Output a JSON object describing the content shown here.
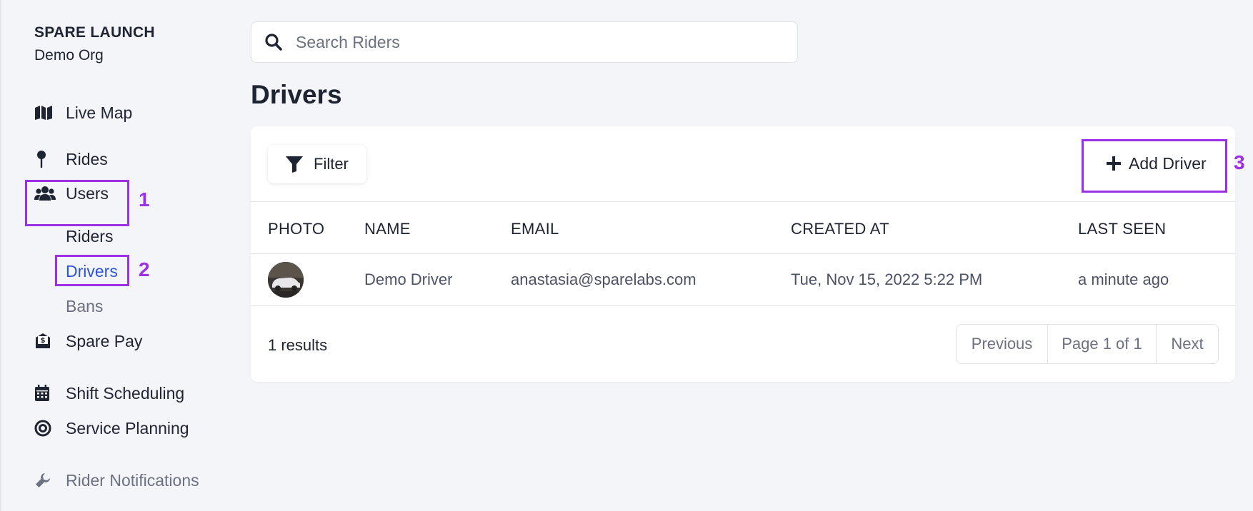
{
  "org": {
    "name": "SPARE LAUNCH",
    "subtitle": "Demo Org"
  },
  "sidebar": {
    "items": [
      {
        "label": "Live Map",
        "icon": "map-icon"
      },
      {
        "label": "Rides",
        "icon": "pin-icon"
      },
      {
        "label": "Users",
        "icon": "users-icon"
      },
      {
        "label": "Spare Pay",
        "icon": "money-envelope-icon"
      },
      {
        "label": "Shift Scheduling",
        "icon": "calendar-icon"
      },
      {
        "label": "Service Planning",
        "icon": "target-icon"
      },
      {
        "label": "Rider Notifications",
        "icon": "wrench-icon"
      }
    ],
    "users_sub": [
      {
        "label": "Riders"
      },
      {
        "label": "Drivers"
      },
      {
        "label": "Bans"
      }
    ]
  },
  "annotations": [
    "1",
    "2",
    "3"
  ],
  "search": {
    "placeholder": "Search Riders"
  },
  "page": {
    "title": "Drivers"
  },
  "toolbar": {
    "filter_label": "Filter",
    "add_label": "Add Driver"
  },
  "table": {
    "columns": [
      "PHOTO",
      "NAME",
      "EMAIL",
      "CREATED AT",
      "LAST SEEN"
    ],
    "rows": [
      {
        "name": "Demo Driver",
        "email": "anastasia@sparelabs.com",
        "created_at": "Tue, Nov 15, 2022 5:22 PM",
        "last_seen": "a minute ago"
      }
    ]
  },
  "footer": {
    "results": "1 results",
    "pagination": {
      "previous": "Previous",
      "page": "Page 1 of 1",
      "next": "Next"
    }
  },
  "colors": {
    "accent": "#2d55d8",
    "annotation": "#9b30e6",
    "background": "#f4f5f9"
  }
}
